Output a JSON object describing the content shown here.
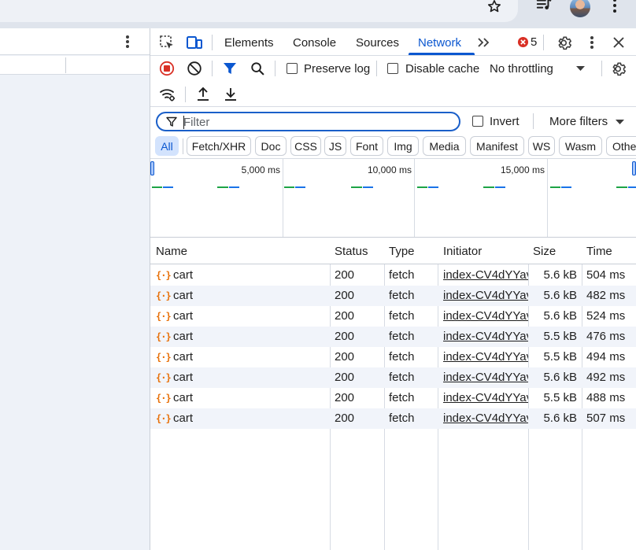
{
  "browser": {
    "icons": [
      "star-icon",
      "media-playlist-icon",
      "avatar",
      "kebab-menu-icon"
    ]
  },
  "devtools": {
    "tabs": [
      {
        "label": "Elements"
      },
      {
        "label": "Console"
      },
      {
        "label": "Sources"
      },
      {
        "label": "Network",
        "active": true
      }
    ],
    "error_count": "5",
    "toolbar": {
      "preserve_log": "Preserve log",
      "disable_cache": "Disable cache",
      "throttling": "No throttling"
    },
    "filter": {
      "placeholder": "Filter",
      "invert": "Invert",
      "more_filters": "More filters"
    },
    "chips": [
      "All",
      "Fetch/XHR",
      "Doc",
      "CSS",
      "JS",
      "Font",
      "Img",
      "Media",
      "Manifest",
      "WS",
      "Wasm",
      "Othe"
    ],
    "active_chip": "All",
    "timeline": {
      "ticks": [
        "5,000 ms",
        "10,000 ms",
        "15,000 ms"
      ]
    },
    "table": {
      "columns": [
        "Name",
        "Status",
        "Type",
        "Initiator",
        "Size",
        "Time"
      ],
      "rows": [
        {
          "name": "cart",
          "status": "200",
          "type": "fetch",
          "initiator": "index-CV4dYYav",
          "size": "5.6 kB",
          "time": "504 ms"
        },
        {
          "name": "cart",
          "status": "200",
          "type": "fetch",
          "initiator": "index-CV4dYYav",
          "size": "5.6 kB",
          "time": "482 ms"
        },
        {
          "name": "cart",
          "status": "200",
          "type": "fetch",
          "initiator": "index-CV4dYYav",
          "size": "5.6 kB",
          "time": "524 ms"
        },
        {
          "name": "cart",
          "status": "200",
          "type": "fetch",
          "initiator": "index-CV4dYYav",
          "size": "5.5 kB",
          "time": "476 ms"
        },
        {
          "name": "cart",
          "status": "200",
          "type": "fetch",
          "initiator": "index-CV4dYYav",
          "size": "5.5 kB",
          "time": "494 ms"
        },
        {
          "name": "cart",
          "status": "200",
          "type": "fetch",
          "initiator": "index-CV4dYYav",
          "size": "5.6 kB",
          "time": "492 ms"
        },
        {
          "name": "cart",
          "status": "200",
          "type": "fetch",
          "initiator": "index-CV4dYYav",
          "size": "5.5 kB",
          "time": "488 ms"
        },
        {
          "name": "cart",
          "status": "200",
          "type": "fetch",
          "initiator": "index-CV4dYYav",
          "size": "5.6 kB",
          "time": "507 ms"
        }
      ]
    }
  },
  "colors": {
    "accent": "#0b57d0",
    "record_red": "#d93025",
    "fetch_icon": "#e8710a"
  }
}
